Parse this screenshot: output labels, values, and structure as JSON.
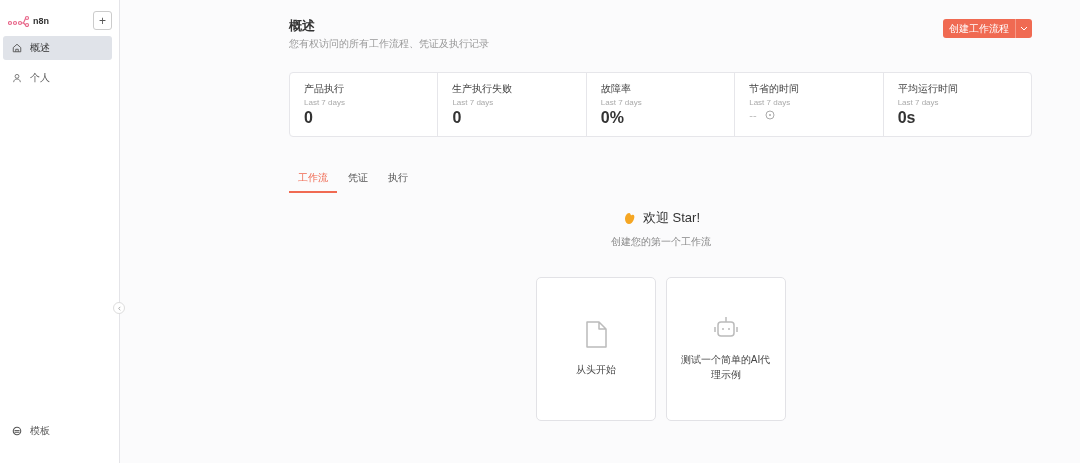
{
  "sidebar": {
    "logo": "n8n",
    "add_button": "+",
    "items": [
      {
        "kind": "home",
        "label": "概述",
        "selected": true
      },
      {
        "kind": "person",
        "label": "个人",
        "selected": false
      }
    ],
    "bottom_items": [
      {
        "kind": "template",
        "label": "模板",
        "selected": false
      }
    ]
  },
  "header": {
    "title": "概述",
    "subtitle": "您有权访问的所有工作流程、凭证及执行记录",
    "create_button": "创建工作流程"
  },
  "stats": [
    {
      "label": "产品执行",
      "period": "Last 7 days",
      "value": "0",
      "kind": "value"
    },
    {
      "label": "生产执行失败",
      "period": "Last 7 days",
      "value": "0",
      "kind": "value"
    },
    {
      "label": "故障率",
      "period": "Last 7 days",
      "value": "0%",
      "kind": "value"
    },
    {
      "label": "节省的时间",
      "period": "Last 7 days",
      "value": "--",
      "kind": "info"
    },
    {
      "label": "平均运行时间",
      "period": "Last 7 days",
      "value": "0s",
      "kind": "value"
    }
  ],
  "tabs": [
    {
      "label": "工作流",
      "selected": true
    },
    {
      "label": "凭证",
      "selected": false
    },
    {
      "label": "执行",
      "selected": false
    }
  ],
  "empty_state": {
    "greeting": "欢迎 Star!",
    "subtitle": "创建您的第一个工作流"
  },
  "cards": [
    {
      "kind": "file",
      "label": "从头开始"
    },
    {
      "kind": "robot",
      "label": "测试一个简单的AI代理示例"
    }
  ]
}
